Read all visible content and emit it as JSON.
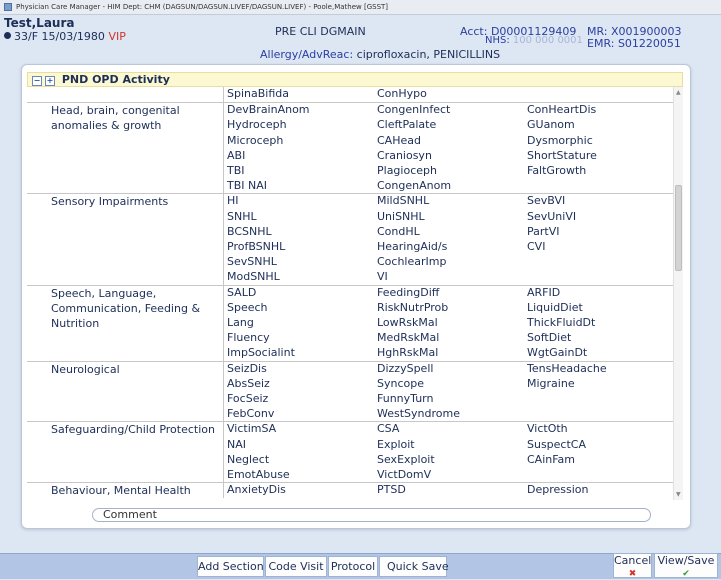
{
  "window": {
    "title": "Physician Care Manager - HIM Dept: CHM (DAGSUN/DAGSUN.LIVEF/DAGSUN.LIVEF) - Poole,Mathew [GSST]"
  },
  "patient": {
    "name": "Test,Laura",
    "age_sex_dob": "33/F 15/03/1980",
    "vip": "VIP",
    "encounter": "PRE CLI  DGMAIN",
    "acct_label": "Acct:",
    "acct": "D00001129409",
    "mr_label": "MR:",
    "mr": "X001900003",
    "nhs_label": "NHS:",
    "nhs": "100 000 0001",
    "emr_label": "EMR:",
    "emr": "S01220051",
    "allergy_label": "Allergy/AdvReac:",
    "allergy": "ciprofloxacin, PENICILLINS"
  },
  "section": {
    "toggle_collapse": "−",
    "toggle_expand": "+",
    "title": "PND OPD Activity"
  },
  "groups": [
    {
      "category": "",
      "rows": [
        [
          "SpinaBifida",
          "ConHypo",
          ""
        ]
      ]
    },
    {
      "category": "Head, brain, congenital anomalies & growth",
      "rows": [
        [
          "DevBrainAnom",
          "CongenInfect",
          "ConHeartDis"
        ],
        [
          "Hydroceph",
          "CleftPalate",
          "GUanom"
        ],
        [
          "Microceph",
          "CAHead",
          "Dysmorphic"
        ],
        [
          "ABI",
          "Craniosyn",
          "ShortStature"
        ],
        [
          "TBI",
          "Plagioceph",
          "FaltGrowth"
        ],
        [
          "TBI NAI",
          "CongenAnom",
          ""
        ]
      ]
    },
    {
      "category": "Sensory Impairments",
      "rows": [
        [
          "HI",
          "MildSNHL",
          "SevBVI"
        ],
        [
          "SNHL",
          "UniSNHL",
          "SevUniVI"
        ],
        [
          "BCSNHL",
          "CondHL",
          "PartVI"
        ],
        [
          "ProfBSNHL",
          "HearingAid/s",
          "CVI"
        ],
        [
          "SevSNHL",
          "CochlearImp",
          ""
        ],
        [
          "ModSNHL",
          "VI",
          ""
        ]
      ]
    },
    {
      "category": "Speech, Language, Communication, Feeding & Nutrition",
      "rows": [
        [
          "SALD",
          "FeedingDiff",
          "ARFID"
        ],
        [
          "Speech",
          "RiskNutrProb",
          "LiquidDiet"
        ],
        [
          "Lang",
          "LowRskMal",
          "ThickFluidDt"
        ],
        [
          "Fluency",
          "MedRskMal",
          "SoftDiet"
        ],
        [
          "ImpSocialint",
          "HghRskMal",
          "WgtGainDt"
        ]
      ]
    },
    {
      "category": "Neurological",
      "rows": [
        [
          "SeizDis",
          "DizzySpell",
          "TensHeadache"
        ],
        [
          "AbsSeiz",
          "Syncope",
          "Migraine"
        ],
        [
          "FocSeiz",
          "FunnyTurn",
          ""
        ],
        [
          "FebConv",
          "WestSyndrome",
          ""
        ]
      ]
    },
    {
      "category": "Safeguarding/Child Protection",
      "rows": [
        [
          "VictimSA",
          "CSA",
          "VictOth"
        ],
        [
          "NAI",
          "Exploit",
          "SuspectCA"
        ],
        [
          "Neglect",
          "SexExploit",
          "CAinFam"
        ],
        [
          "EmotAbuse",
          "VictDomV",
          ""
        ]
      ]
    },
    {
      "category": "Behaviour, Mental Health",
      "rows": [
        [
          "AnxietyDis",
          "PTSD",
          "Depression"
        ]
      ]
    }
  ],
  "comment": {
    "label": "Comment"
  },
  "toolbar": {
    "add_section": "Add Section",
    "code_visit": "Code Visit",
    "protocol": "Protocol",
    "quick_save": "Quick Save",
    "cancel": "Cancel",
    "view_save": "View/Save"
  }
}
